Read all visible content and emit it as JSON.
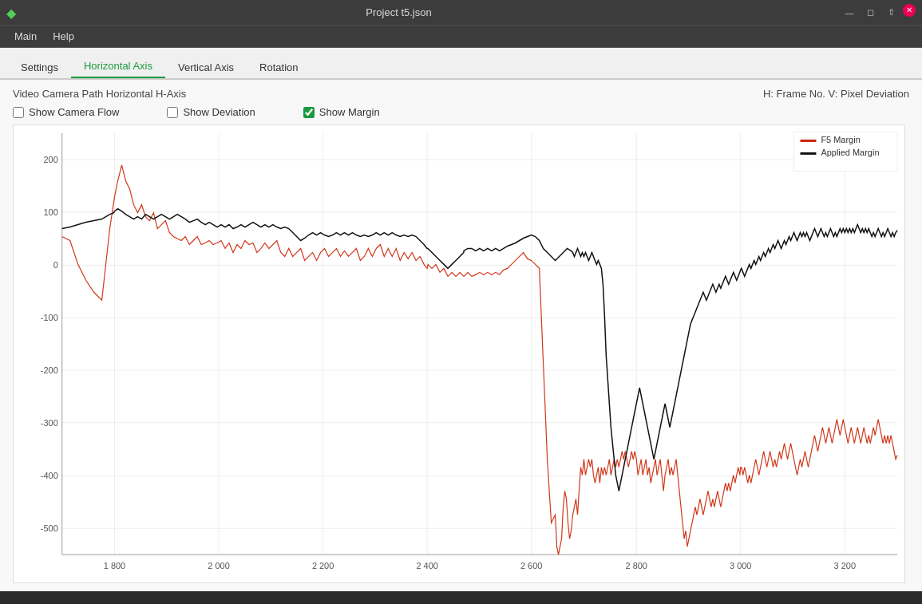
{
  "titlebar": {
    "title": "Project t5.json",
    "app_icon": "◆"
  },
  "menubar": {
    "items": [
      "Main",
      "Help"
    ]
  },
  "tabs": {
    "items": [
      "Settings",
      "Horizontal Axis",
      "Vertical Axis",
      "Rotation"
    ],
    "active": 1
  },
  "chart": {
    "subtitle_left": "Video Camera Path Horizontal H-Axis",
    "subtitle_right": "H: Frame No. V: Pixel Deviation",
    "show_camera_flow_label": "Show Camera Flow",
    "show_deviation_label": "Show Deviation",
    "show_margin_label": "Show Margin",
    "show_camera_flow_checked": false,
    "show_deviation_checked": false,
    "show_margin_checked": true,
    "legend": {
      "f5_margin_label": "F5 Margin",
      "applied_margin_label": "Applied Margin",
      "f5_color": "#cc2200",
      "applied_color": "#111111"
    },
    "x_labels": [
      "1 800",
      "2 000",
      "2 200",
      "2 400",
      "2 600",
      "2 800",
      "3 000",
      "3 200"
    ],
    "y_labels": [
      "200",
      "100",
      "0",
      "-100",
      "-200",
      "-300",
      "-400",
      "-500"
    ]
  }
}
